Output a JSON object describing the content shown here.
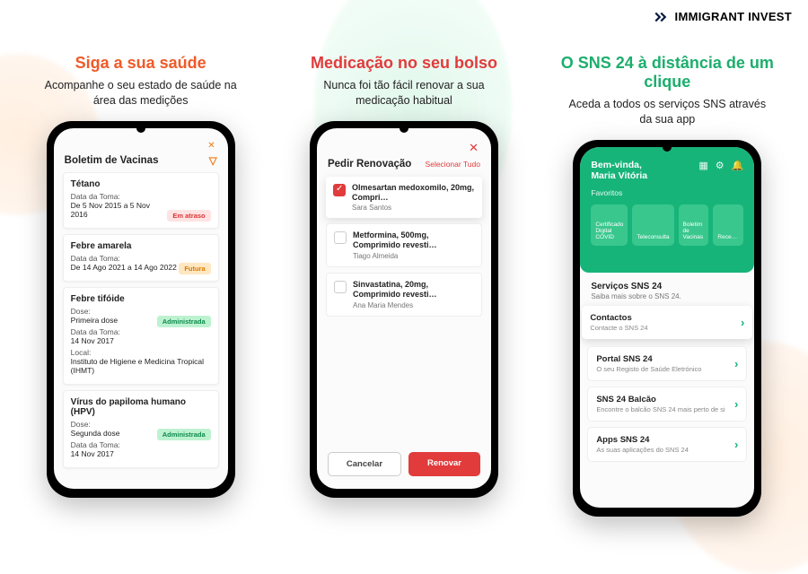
{
  "brand": {
    "name": "IMMIGRANT INVEST"
  },
  "columns": [
    {
      "title": "Siga a sua saúde",
      "subtitle": "Acompanhe o seu estado de saúde na área das medições",
      "screen": {
        "heading": "Boletim de Vacinas",
        "vaccines": [
          {
            "name": "Tétano",
            "date_label": "Data da Toma:",
            "date_value": "De 5 Nov 2015 a 5 Nov 2016",
            "status": "Em atraso",
            "status_kind": "late"
          },
          {
            "name": "Febre amarela",
            "date_label": "Data da Toma:",
            "date_value": "De 14 Ago 2021 a 14 Ago 2022",
            "status": "Futura",
            "status_kind": "warn"
          },
          {
            "name": "Febre tifóide",
            "dose_label": "Dose:",
            "dose_value": "Primeira dose",
            "date_label": "Data da Toma:",
            "date_value": "14 Nov 2017",
            "local_label": "Local:",
            "local_value": "Instituto de Higiene e Medicina Tropical (IHMT)",
            "status": "Administrada",
            "status_kind": "ok"
          },
          {
            "name": "Vírus do papiloma humano (HPV)",
            "dose_label": "Dose:",
            "dose_value": "Segunda dose",
            "date_label": "Data da Toma:",
            "date_value": "14 Nov 2017",
            "status": "Administrada",
            "status_kind": "ok"
          }
        ]
      }
    },
    {
      "title": "Medicação no seu bolso",
      "subtitle": "Nunca foi tão fácil renovar a sua medicação habitual",
      "screen": {
        "heading": "Pedir Renovação",
        "select_all": "Selecionar Tudo",
        "meds": [
          {
            "name": "Olmesartan medoxomilo, 20mg, Compri…",
            "patient": "Sara Santos",
            "checked": true,
            "featured": true
          },
          {
            "name": "Metformina, 500mg, Comprimido revesti…",
            "patient": "Tiago Almeida",
            "checked": false
          },
          {
            "name": "Sinvastatina, 20mg, Comprimido revesti…",
            "patient": "Ana Maria Mendes",
            "checked": false
          }
        ],
        "cancel": "Cancelar",
        "submit": "Renovar"
      }
    },
    {
      "title": "O SNS 24 à distância de um clique",
      "subtitle": "Aceda a todos os serviços SNS através da sua app",
      "screen": {
        "greeting_prefix": "Bem-vinda,",
        "greeting_name": "Maria Vitória",
        "favorites_label": "Favoritos",
        "tiles": [
          "Certificado Digital COVID",
          "Teleconsulta",
          "Boletim de Vacinas",
          "Rece…"
        ],
        "section_title": "Serviços SNS 24",
        "section_sub": "Saiba mais sobre o SNS 24.",
        "cards": [
          {
            "title": "Contactos",
            "sub": "Contacte o SNS 24",
            "featured": true
          },
          {
            "title": "Portal SNS 24",
            "sub": "O seu Registo de Saúde Eletrónico"
          },
          {
            "title": "SNS 24 Balcão",
            "sub": "Encontre o balcão SNS 24 mais perto de si"
          },
          {
            "title": "Apps SNS 24",
            "sub": "As suas aplicações do SNS 24"
          }
        ]
      }
    }
  ]
}
